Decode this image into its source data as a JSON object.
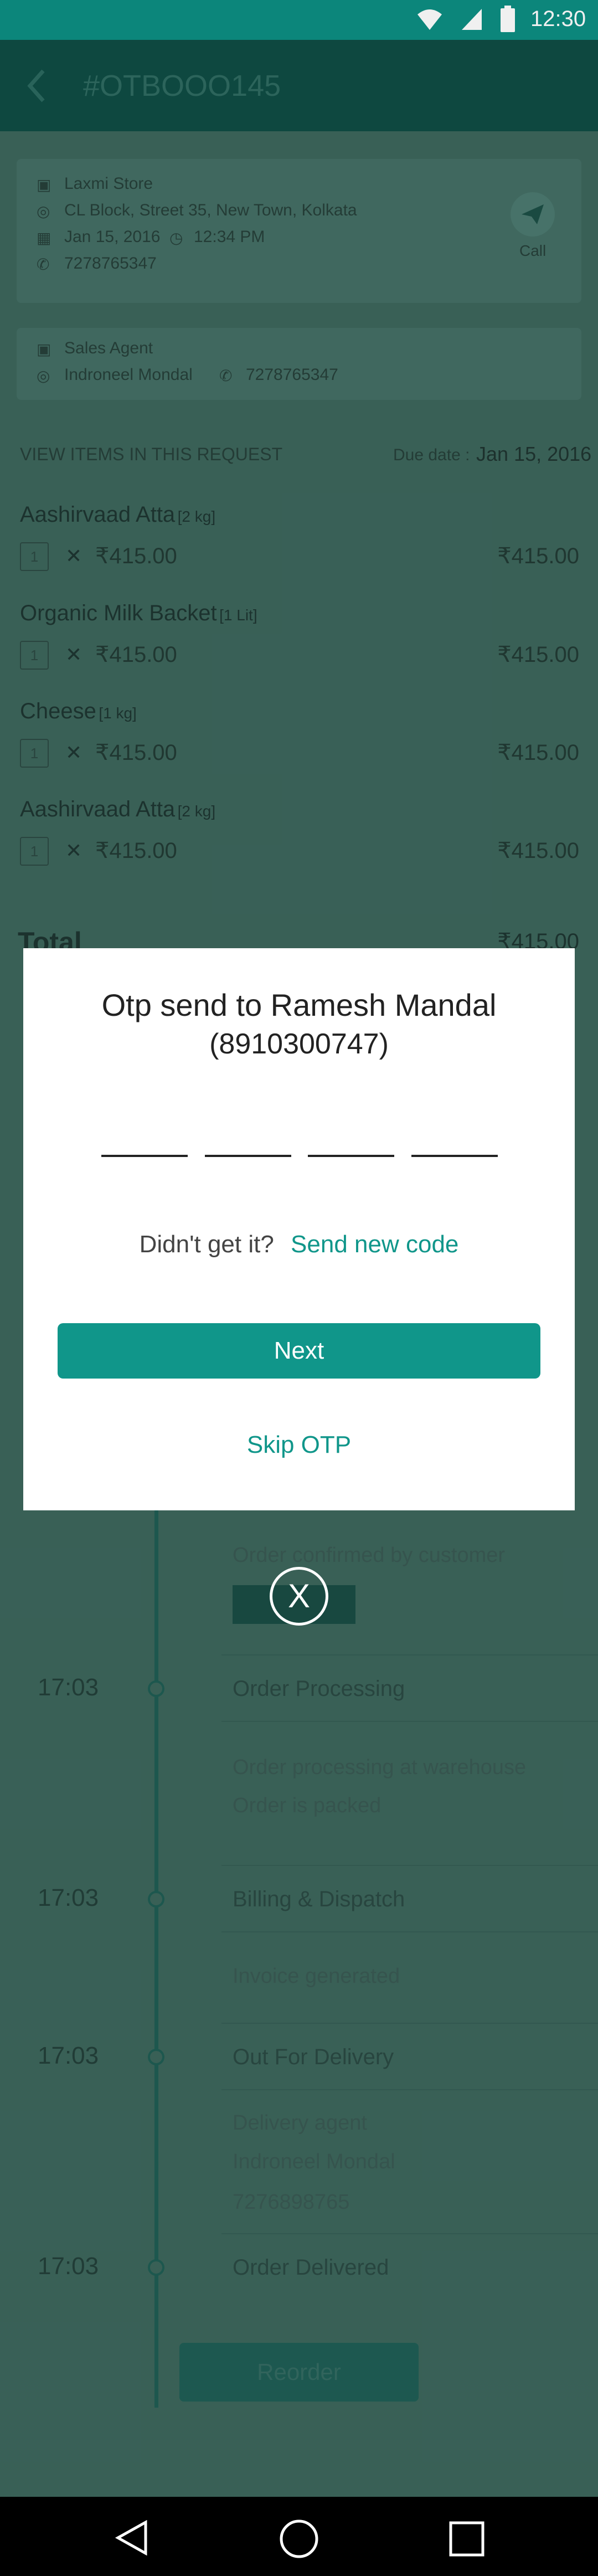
{
  "status_bar": {
    "time": "12:30"
  },
  "header": {
    "title": "#OTBOOO145"
  },
  "store": {
    "name": "Laxmi Store",
    "address": "CL Block, Street 35, New Town, Kolkata",
    "date": "Jan 15, 2016",
    "time": "12:34 PM",
    "phone": "7278765347",
    "call_label": "Call"
  },
  "agent": {
    "label": "Sales Agent",
    "name": "Indroneel Mondal",
    "phone": "7278765347"
  },
  "items_section": {
    "heading": "VIEW ITEMS IN THIS REQUEST",
    "due_label": "Due date :",
    "due_date": "Jan 15, 2016"
  },
  "items": [
    {
      "name": "Aashirvaad Atta",
      "unit": "[2 kg]",
      "qty": "1",
      "price": "₹415.00",
      "total": "₹415.00"
    },
    {
      "name": "Organic Milk Backet",
      "unit": "[1 Lit]",
      "qty": "1",
      "price": "₹415.00",
      "total": "₹415.00"
    },
    {
      "name": "Cheese",
      "unit": "[1 kg]",
      "qty": "1",
      "price": "₹415.00",
      "total": "₹415.00"
    },
    {
      "name": "Aashirvaad Atta",
      "unit": "[2 kg]",
      "qty": "1",
      "price": "₹415.00",
      "total": "₹415.00"
    }
  ],
  "total": {
    "label": "Total",
    "value": "₹415.00"
  },
  "timeline": [
    {
      "time": "",
      "title": "",
      "subs": [
        "Order confirmed by customer"
      ]
    },
    {
      "time": "17:03",
      "title": "Order Processing",
      "subs": [
        "Order processing at warehouse",
        "Order is packed"
      ]
    },
    {
      "time": "17:03",
      "title": "Billing & Dispatch",
      "subs": [
        "Invoice generated"
      ]
    },
    {
      "time": "17:03",
      "title": "Out For Delivery",
      "subs": [
        "Delivery agent",
        "Indroneel Mondal",
        "7276898765"
      ]
    },
    {
      "time": "17:03",
      "title": "Order Delivered",
      "subs": []
    }
  ],
  "reorder_label": "Reorder",
  "modal": {
    "title": "Otp send to Ramesh Mandal",
    "phone": "(8910300747)",
    "resend_prompt": "Didn't get it?",
    "resend_link": "Send new code",
    "next_label": "Next",
    "skip_label": "Skip OTP"
  },
  "close_label": "X",
  "colors": {
    "accent": "#10968a",
    "header": "#0f4d45",
    "status_bar": "#0d8f83"
  }
}
